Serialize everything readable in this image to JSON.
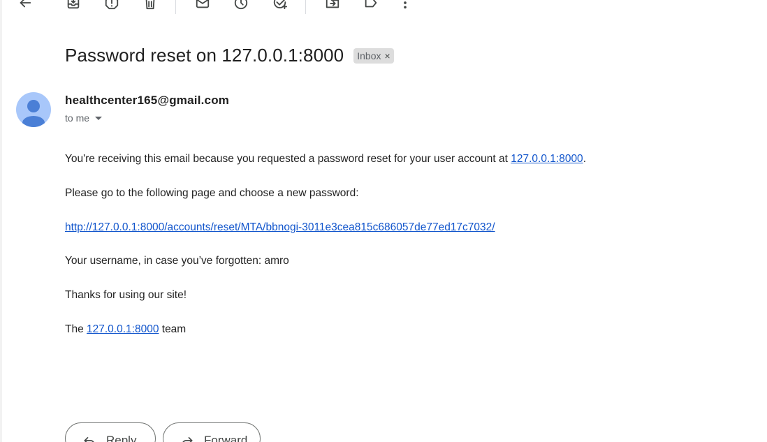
{
  "toolbar": {
    "icons": [
      "back-arrow-icon",
      "archive-icon",
      "report-spam-icon",
      "delete-icon",
      "mark-unread-icon",
      "snooze-icon",
      "add-to-tasks-icon",
      "move-to-icon",
      "labels-icon",
      "more-icon"
    ]
  },
  "email": {
    "subject": "Password reset on 127.0.0.1:8000",
    "label": "Inbox",
    "label_remove": "×",
    "sender": "healthcenter165@gmail.com",
    "recipient": "to me",
    "body": {
      "line1_before": "You're receiving this email because you requested a password reset for your user account at ",
      "line1_link": "127.0.0.1:8000",
      "line1_after": ".",
      "line2": "Please go to the following page and choose a new password:",
      "reset_link": "http://127.0.0.1:8000/accounts/reset/MTA/bbnogi-3011e3cea815c686057de77ed17c7032/",
      "line4": "Your username, in case you’ve forgotten: amro",
      "line5": "Thanks for using our site!",
      "line6_before": "The ",
      "line6_link": "127.0.0.1:8000",
      "line6_after": " team"
    }
  },
  "actions": {
    "reply": "Reply",
    "forward": "Forward"
  },
  "colors": {
    "link": "#1155cc",
    "avatar_bg": "#a8c7fa",
    "avatar_fg": "#4a7fd6",
    "chip_bg": "#dddddd"
  }
}
